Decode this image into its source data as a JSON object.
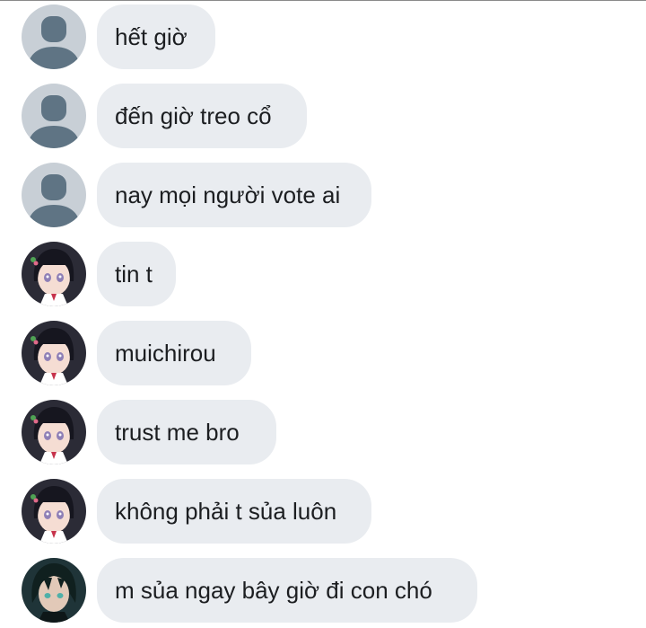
{
  "messages": [
    {
      "avatar": "default-avatar-icon",
      "text": "hết giờ"
    },
    {
      "avatar": "default-avatar-icon",
      "text": "đến giờ treo cổ"
    },
    {
      "avatar": "default-avatar-icon",
      "text": "nay mọi người vote ai"
    },
    {
      "avatar": "anime-girl-avatar",
      "text": "tin t"
    },
    {
      "avatar": "anime-girl-avatar",
      "text": "muichirou"
    },
    {
      "avatar": "anime-girl-avatar",
      "text": "trust me bro"
    },
    {
      "avatar": "anime-girl-avatar",
      "text": "không phải t sủa luôn"
    },
    {
      "avatar": "anime-boy-avatar",
      "text": "m sủa ngay bây giờ đi con chó"
    }
  ],
  "colors": {
    "bubble": "#e9ecf0",
    "text": "#1c1e21",
    "default_avatar_bg": "#c8cfd6",
    "default_avatar_fg": "#5f7484"
  }
}
